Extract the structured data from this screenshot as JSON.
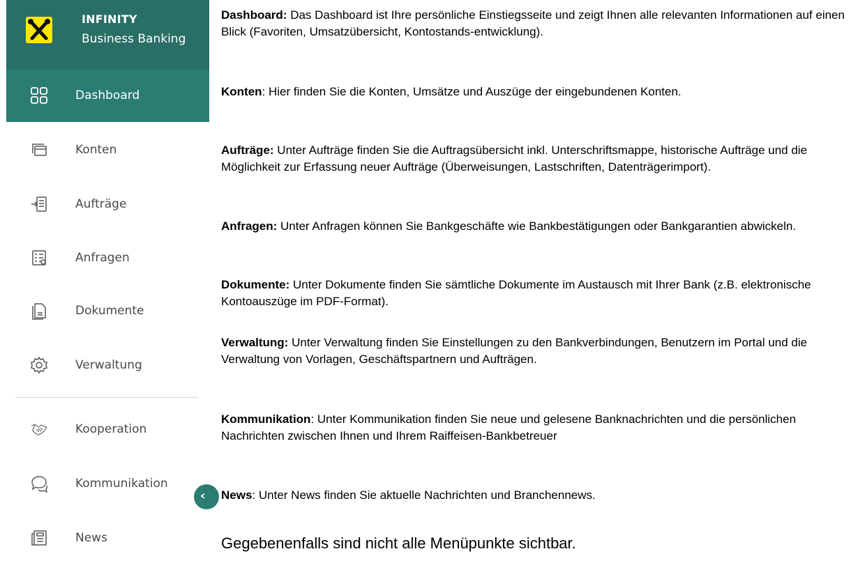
{
  "brand": {
    "title": "INFINITY",
    "subtitle": "Business Banking",
    "logo_icon": "raiffeisen-cross-icon",
    "brand_color": "#2a6f66",
    "accent_color": "#ffe600"
  },
  "nav": {
    "items": [
      {
        "label": "Dashboard",
        "icon": "dashboard-icon",
        "active": true
      },
      {
        "label": "Konten",
        "icon": "accounts-icon"
      },
      {
        "label": "Aufträge",
        "icon": "orders-icon"
      },
      {
        "label": "Anfragen",
        "icon": "requests-icon"
      },
      {
        "label": "Dokumente",
        "icon": "documents-icon"
      },
      {
        "label": "Verwaltung",
        "icon": "settings-gear-icon"
      },
      {
        "label": "Kooperation",
        "icon": "handshake-icon"
      },
      {
        "label": "Kommunikation",
        "icon": "chat-bubbles-icon"
      },
      {
        "label": "News",
        "icon": "newspaper-icon"
      }
    ],
    "collapse_icon": "chevron-left-icon",
    "active_color": "#2b7d72"
  },
  "content": {
    "paragraphs": [
      {
        "term": "Dashboard:",
        "text": " Das Dashboard ist Ihre persönliche Einstiegsseite und zeigt Ihnen alle relevanten Informationen auf einen Blick (Favoriten, Umsatzübersicht, Kontostands-entwicklung)."
      },
      {
        "term": "Konten",
        "text": ": Hier finden Sie die Konten, Umsätze und Auszüge der eingebundenen Konten."
      },
      {
        "term": "Aufträge:",
        "text": " Unter Aufträge finden Sie die Auftragsübersicht inkl. Unterschriftsmappe, historische Aufträge und die Möglichkeit zur Erfassung neuer Aufträge (Überweisungen, Lastschriften, Datenträgerimport)."
      },
      {
        "term": "Anfragen:",
        "text": " Unter Anfragen können Sie Bankgeschäfte wie Bankbestätigungen oder Bankgarantien abwickeln."
      },
      {
        "term": "Dokumente:",
        "text": " Unter Dokumente finden Sie sämtliche Dokumente im Austausch mit Ihrer Bank (z.B. elektronische Kontoauszüge im PDF-Format)."
      },
      {
        "term": "Verwaltung:",
        "text": " Unter Verwaltung finden Sie Einstellungen zu den Bankverbindungen, Benutzern im Portal und die Verwaltung von Vorlagen, Geschäftspartnern und Aufträgen."
      },
      {
        "term": "Kommunikation",
        "text": ": Unter Kommunikation finden Sie neue und gelesene Banknachrichten und die persönlichen Nachrichten zwischen Ihnen und Ihrem Raiffeisen-Bankbetreuer"
      },
      {
        "term": "News",
        "text": ": Unter News finden Sie aktuelle Nachrichten und Branchennews."
      }
    ],
    "footnote": "Gegebenenfalls sind nicht alle Menüpunkte sichtbar."
  }
}
